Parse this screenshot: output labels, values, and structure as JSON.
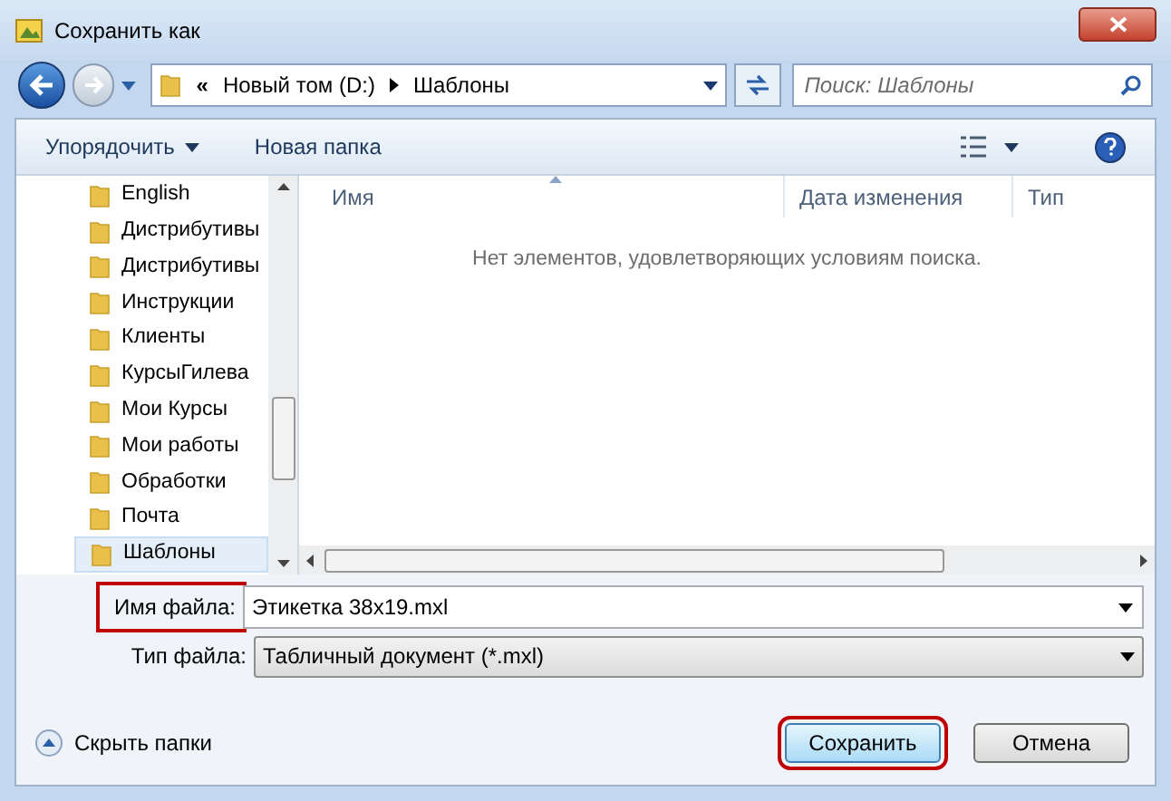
{
  "window": {
    "title": "Сохранить как"
  },
  "address": {
    "prefix": "«",
    "segments": [
      "Новый том (D:)",
      "Шаблоны"
    ]
  },
  "search": {
    "placeholder": "Поиск: Шаблоны"
  },
  "toolbar": {
    "organize": "Упорядочить",
    "new_folder": "Новая папка"
  },
  "folders": [
    {
      "name": "English",
      "selected": false
    },
    {
      "name": "Дистрибутивы",
      "selected": false
    },
    {
      "name": "Дистрибутивы",
      "selected": false
    },
    {
      "name": "Инструкции",
      "selected": false
    },
    {
      "name": "Клиенты",
      "selected": false
    },
    {
      "name": "КурсыГилева",
      "selected": false
    },
    {
      "name": "Мои Курсы",
      "selected": false
    },
    {
      "name": "Мои работы",
      "selected": false
    },
    {
      "name": "Обработки",
      "selected": false
    },
    {
      "name": "Почта",
      "selected": false
    },
    {
      "name": "Шаблоны",
      "selected": true
    }
  ],
  "columns": [
    "Имя",
    "Дата изменения",
    "Тип"
  ],
  "empty_message": "Нет элементов, удовлетворяющих условиям поиска.",
  "file_name": {
    "label": "Имя файла:",
    "value": "Этикетка 38x19.mxl",
    "highlighted": true
  },
  "file_type": {
    "label": "Тип файла:",
    "value": "Табличный документ (*.mxl)"
  },
  "hide_folders": "Скрыть папки",
  "buttons": [
    {
      "label": "Сохранить",
      "kind": "primary",
      "highlighted": true
    },
    {
      "label": "Отмена",
      "kind": "normal",
      "highlighted": false
    }
  ]
}
